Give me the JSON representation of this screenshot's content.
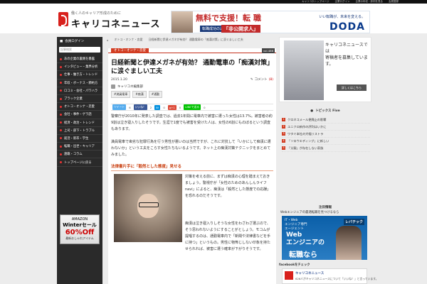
{
  "topbar": {
    "links": [
      "キャリコネトップページ",
      "企業ログイン",
      "企業の年収・評判を見る",
      "会員登録",
      "キャリコネ会員登録"
    ]
  },
  "header": {
    "tagline": "働く人のキャリア形成のために",
    "logo_text": "キャリコネニュース"
  },
  "banner": {
    "main": "無料で支援！転 職",
    "sub": "転職成功の近道は",
    "badge": "「非公開求人」",
    "right_top": "いい転職が、未来を変える。",
    "brand": "DODA"
  },
  "breadcrumb": {
    "items": [
      "トップ",
      "オトコ・オンナ・恋愛",
      "日経新聞と伊達メガネが有効？ 通勤電車の「痴漢対策」に涙ぐましい工夫"
    ]
  },
  "sidebar": {
    "login": "会員ログイン",
    "search_placeholder": "記事検索",
    "items": [
      "あの企業の裏側を暴露",
      "インタビュー・業界分析",
      "仕事・働き方・トレンド",
      "年収・ボーナス・節約方",
      "ロコミ・会社・パワハラ",
      "ブラック企業",
      "オトコ・オンナ・恋愛",
      "会社・事件・ゲラ話",
      "経済・政治・トレンド",
      "上司・部下・トラブル",
      "就活・新卒・学生",
      "転職・出世・キャリア",
      "連載・コラム",
      "トップページに戻る"
    ],
    "ad": {
      "line1": "AMAZON",
      "line2": "Winterセール",
      "line3": "60%Off",
      "line4": "最新おしゃれアイテム"
    }
  },
  "article": {
    "category": "オトコ・オンナ・恋愛",
    "vol": "vol.486",
    "title": "日経新聞と伊達メガネが有効？ 通勤電車の「痴漢対策」に涙ぐましい工夫",
    "date": "2015.1.20",
    "comment_label": "コメント",
    "comment_count": "(8)",
    "author": "キャリコネ編集部",
    "tags": [
      "#満員電車",
      "#痴漢",
      "#通勤"
    ],
    "share": {
      "tweet": "ツイート",
      "tweet_count": "6",
      "like": "いいね！",
      "like_count": "2",
      "hatena": "B!",
      "hatena_count": "0",
      "gplus": "g+1",
      "gplus_count": "0",
      "line": "LINEで送る",
      "pocket_count": "0"
    },
    "para1": "警察庁が2010年に発表した調査では、過去1年間に電車内で被害に遭った女性は13.7%。被害者の約9割は泣き寝入りしたそうです。生涯で1度でも被害を受けた人は、女性の6割にものぼるという調査もあります。",
    "para2": "満員電車で卑劣な犯罪行為を行う男性が悪いのは当然ですが、これに対抗して「いかにして痴漢に遭わないか」という工夫をこらす女性たちもいるようです。ネット上の痴漢対策テクニックをまとめてみました。",
    "subhead": "法律書片手に「毅然とした態度」見せる",
    "right1_a": "対策を考える前に、まずは痴漢の心理を踏まえておきましょう。警視庁が「女性のためのあんしんライフnavi」によると、痴漢は「毅然とした態度での応酬」を恐れるのだそうです。",
    "right1_link": "女性のためのあんしんライフnavi",
    "right2": "痴漢は泣き寝入りしそうな女性をわざわざ選ぶので、そう思われないようにすることがとしょう。モコムが提唱するのは、通勤電車内で「新聞や法律書などを手に持つ」というもの。男性に物怖じしない印象を持たせられれば、被害に遭う確率が下がりそうです。"
  },
  "right": {
    "banner_text": "キャリコネニュースでは\n寄稿者を募集しています。",
    "banner_button": "詳しくはこちら",
    "topics_title": "トピックス Five",
    "topics": [
      "クロネコメール便廃止の影響",
      "ユニクロ新作の評判はいかに",
      "ワタミ本社の大幅リストラ",
      "「ソロウエディング」に新しい",
      "「父親」が存在しない家族"
    ],
    "attention_title": "注目情報",
    "attention_link": "Webエンジニアの最適転職を見つけるなら",
    "ad2": {
      "line1": "IT・Web\nエンジニア専門\nエージェント",
      "line2": "Web\nエンジニアの",
      "line3": "転職なら",
      "brand": "レバテック"
    },
    "facebook_title": "facebookをチェック",
    "fb_name": "キャリコネニュース",
    "fb_caption": "626人がキャリコネニュースについて「いいね！」と言っています。"
  }
}
